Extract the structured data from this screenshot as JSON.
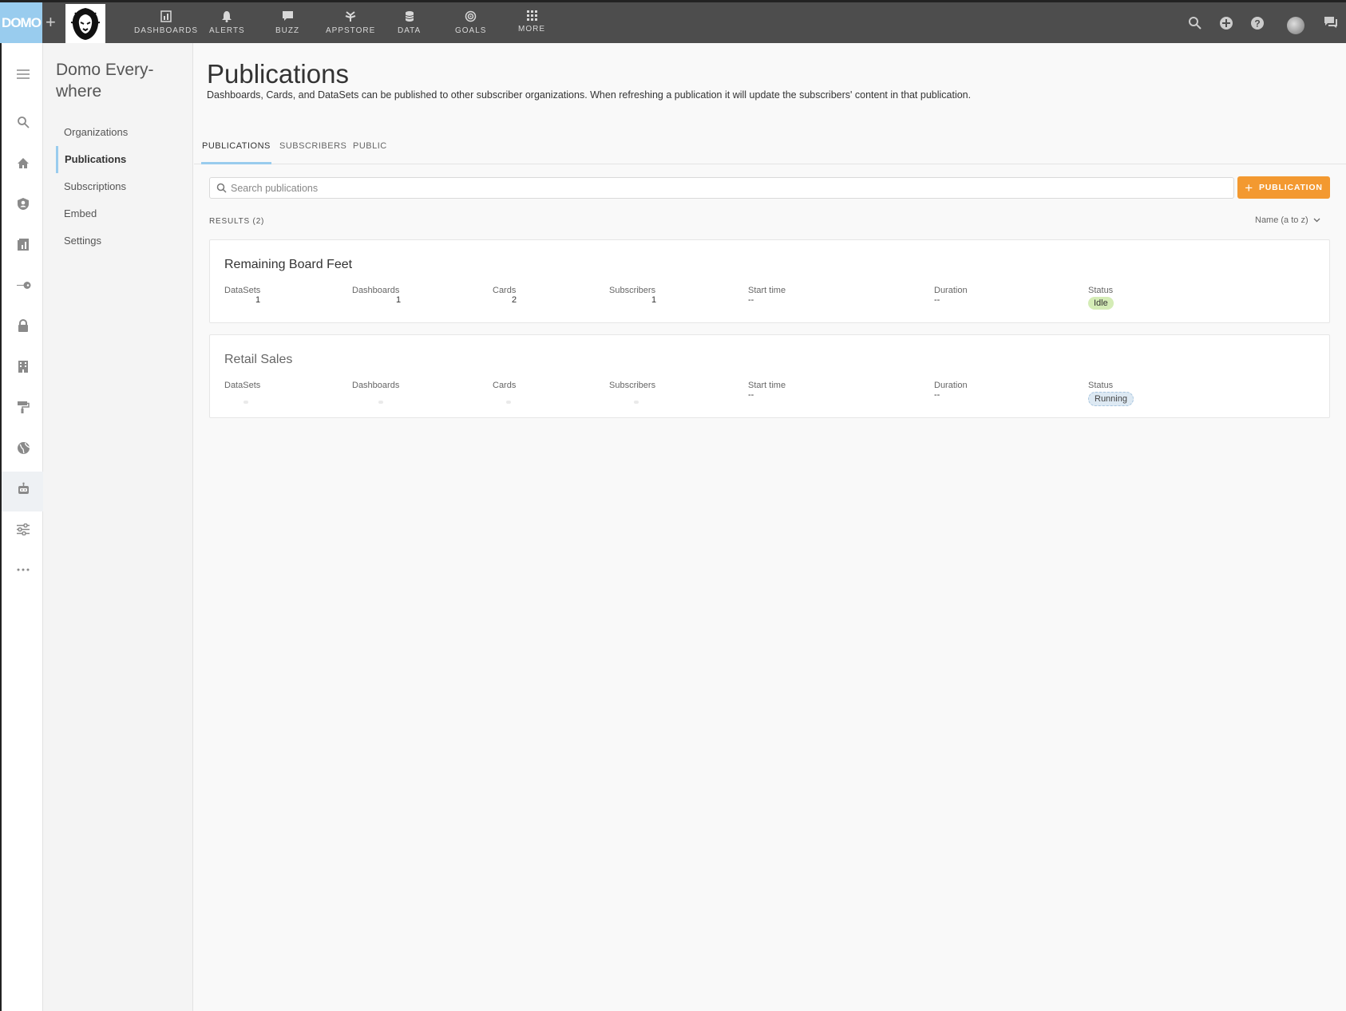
{
  "topbar": {
    "logo_text": "DOMO",
    "nav": [
      "DASHBOARDS",
      "ALERTS",
      "BUZZ",
      "APPSTORE",
      "DATA",
      "GOALS",
      "MORE"
    ]
  },
  "sidebar": {
    "title": "Domo Every-where",
    "items": [
      "Organizations",
      "Publications",
      "Subscriptions",
      "Embed",
      "Settings"
    ]
  },
  "main": {
    "title": "Publications",
    "description": "Dashboards, Cards, and DataSets can be published to other subscriber organizations. When refreshing a publication it will update the subscribers' content in that publication.",
    "tabs": [
      "PUBLICATIONS",
      "SUBSCRIBERS",
      "PUBLIC"
    ],
    "search_placeholder": "Search publications",
    "add_button": "PUBLICATION",
    "results": "RESULTS (2)",
    "sort": "Name (a to z)",
    "stat_labels": [
      "DataSets",
      "Dashboards",
      "Cards",
      "Subscribers",
      "Start time",
      "Duration",
      "Status"
    ],
    "publications": [
      {
        "name": "Remaining Board Feet",
        "datasets": "1",
        "dashboards": "1",
        "cards": "2",
        "subscribers": "1",
        "start_time": "--",
        "duration": "--",
        "status": "Idle"
      },
      {
        "name": "Retail Sales",
        "start_time": "--",
        "duration": "--",
        "status": "Running"
      }
    ]
  },
  "colors": {
    "accent": "#99ccee",
    "button": "#f39930",
    "topbar": "#4d4d4d",
    "idle": "#d4ecb6",
    "running": "#dde9f3"
  }
}
